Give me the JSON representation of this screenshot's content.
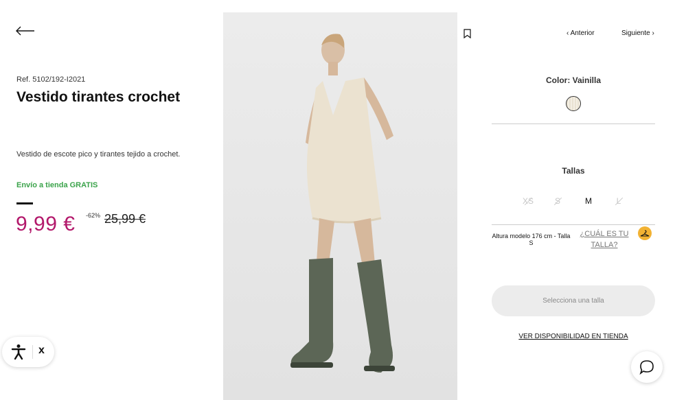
{
  "product": {
    "reference": "Ref. 5102/192-I2021",
    "title": "Vestido tirantes crochet",
    "description": "Vestido de escote pico y tirantes tejido a crochet.",
    "shipping": "Envío a tienda GRATIS",
    "price": "9,99 €",
    "discount": "-62%",
    "old_price": "25,99 €"
  },
  "nav": {
    "prev_label": "Anterior",
    "next_label": "Siguiente"
  },
  "color": {
    "label": "Color: Vainilla"
  },
  "sizes": {
    "label": "Tallas",
    "items": [
      {
        "label": "XS",
        "available": false
      },
      {
        "label": "S",
        "available": false
      },
      {
        "label": "M",
        "available": true
      },
      {
        "label": "L",
        "available": false
      }
    ],
    "model_info": "Altura modelo 176 cm - Talla S",
    "guide_link": "¿CUÁL ES TU TALLA?"
  },
  "actions": {
    "select_size": "Selecciona una talla",
    "availability": "VER DISPONIBILIDAD EN TIENDA"
  },
  "accessibility": {
    "close_label": "x"
  },
  "colors": {
    "price": "#b3186b",
    "shipping": "#3aa34a",
    "hanger_badge": "#f2b233"
  },
  "icons": [
    "arrow-left-icon",
    "bookmark-icon",
    "chevron-left-icon",
    "chevron-right-icon",
    "accessibility-icon",
    "hanger-icon",
    "chat-icon"
  ]
}
